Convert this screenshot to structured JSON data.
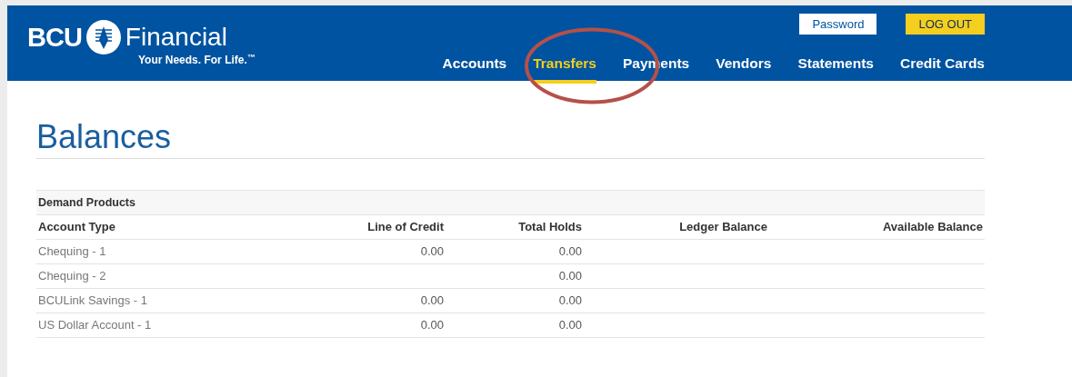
{
  "header": {
    "logo": {
      "left": "BCU",
      "right": "Financial",
      "tagline": "Your Needs. For Life.",
      "tagline_mark": "™"
    },
    "buttons": [
      {
        "label": "Password",
        "kind": "outline"
      },
      {
        "label": "LOG OUT",
        "kind": "accent"
      }
    ],
    "nav": [
      {
        "label": "Accounts",
        "selected": false
      },
      {
        "label": "Transfers",
        "selected": true
      },
      {
        "label": "Payments",
        "selected": false
      },
      {
        "label": "Vendors",
        "selected": false
      },
      {
        "label": "Statements",
        "selected": false
      },
      {
        "label": "Credit Cards",
        "selected": false
      }
    ]
  },
  "page_title": "Balances",
  "table": {
    "section": "Demand Products",
    "columns": [
      "Account Type",
      "Line of Credit",
      "Total Holds",
      "Ledger Balance",
      "Available Balance"
    ],
    "rows": [
      {
        "account": "Chequing - 1",
        "line_of_credit": "0.00",
        "total_holds": "0.00"
      },
      {
        "account": "Chequing - 2",
        "total_holds": "0.00"
      },
      {
        "account": "BCULink Savings - 1",
        "line_of_credit": "0.00",
        "total_holds": "0.00"
      },
      {
        "account": "US Dollar Account - 1",
        "line_of_credit": "0.00",
        "total_holds": "0.00"
      }
    ]
  },
  "annotation": {
    "kind": "ellipse",
    "color": "#b5504a"
  }
}
